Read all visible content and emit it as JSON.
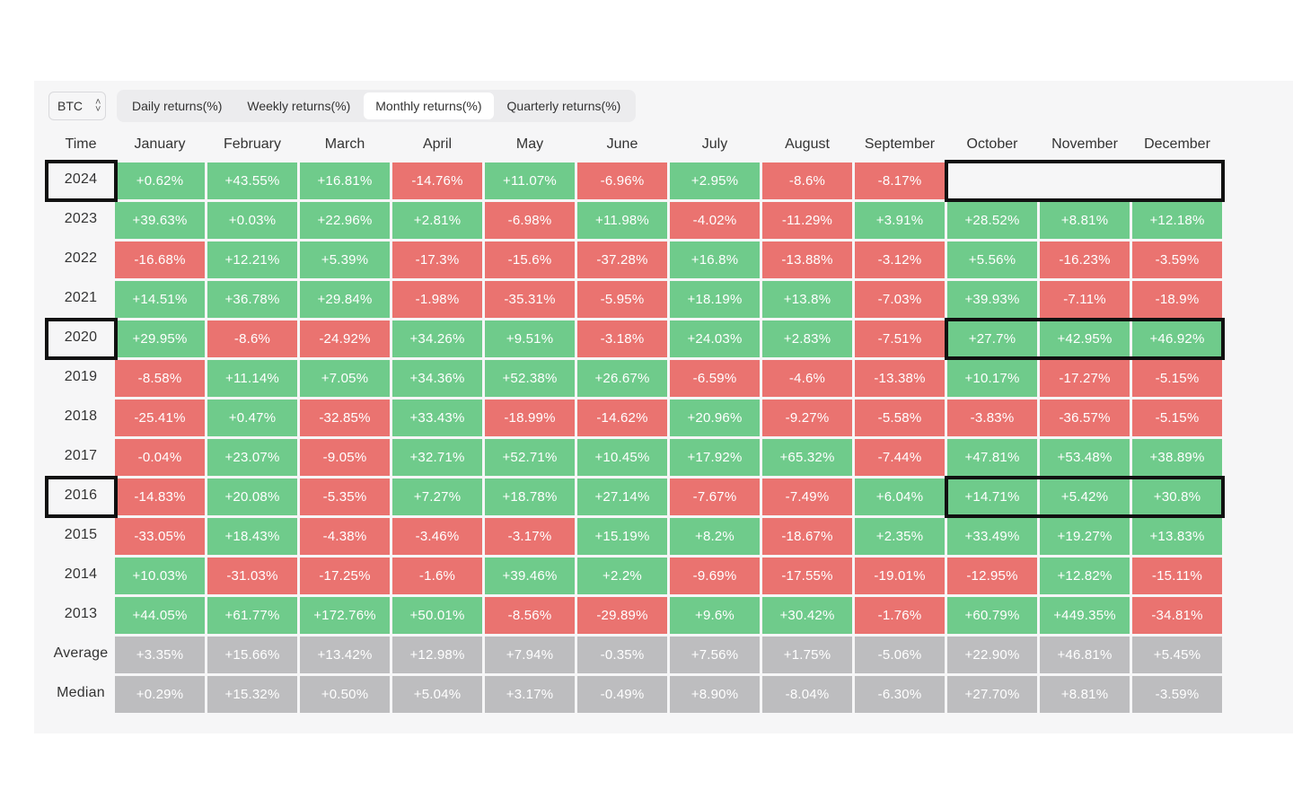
{
  "toolbar": {
    "asset": "BTC",
    "tabs": [
      {
        "label": "Daily returns(%)",
        "active": false
      },
      {
        "label": "Weekly returns(%)",
        "active": false
      },
      {
        "label": "Monthly returns(%)",
        "active": true
      },
      {
        "label": "Quarterly returns(%)",
        "active": false
      }
    ]
  },
  "colors": {
    "positive": "#6fcb8b",
    "negative": "#ea7370",
    "summary": "#bdbdbf",
    "highlight": "#111111"
  },
  "table": {
    "header": [
      "Time",
      "January",
      "February",
      "March",
      "April",
      "May",
      "June",
      "July",
      "August",
      "September",
      "October",
      "November",
      "December"
    ],
    "rows": [
      {
        "label": "2024",
        "values": [
          "+0.62%",
          "+43.55%",
          "+16.81%",
          "-14.76%",
          "+11.07%",
          "-6.96%",
          "+2.95%",
          "-8.6%",
          "-8.17%",
          "",
          "",
          ""
        ]
      },
      {
        "label": "2023",
        "values": [
          "+39.63%",
          "+0.03%",
          "+22.96%",
          "+2.81%",
          "-6.98%",
          "+11.98%",
          "-4.02%",
          "-11.29%",
          "+3.91%",
          "+28.52%",
          "+8.81%",
          "+12.18%"
        ]
      },
      {
        "label": "2022",
        "values": [
          "-16.68%",
          "+12.21%",
          "+5.39%",
          "-17.3%",
          "-15.6%",
          "-37.28%",
          "+16.8%",
          "-13.88%",
          "-3.12%",
          "+5.56%",
          "-16.23%",
          "-3.59%"
        ]
      },
      {
        "label": "2021",
        "values": [
          "+14.51%",
          "+36.78%",
          "+29.84%",
          "-1.98%",
          "-35.31%",
          "-5.95%",
          "+18.19%",
          "+13.8%",
          "-7.03%",
          "+39.93%",
          "-7.11%",
          "-18.9%"
        ]
      },
      {
        "label": "2020",
        "values": [
          "+29.95%",
          "-8.6%",
          "-24.92%",
          "+34.26%",
          "+9.51%",
          "-3.18%",
          "+24.03%",
          "+2.83%",
          "-7.51%",
          "+27.7%",
          "+42.95%",
          "+46.92%"
        ]
      },
      {
        "label": "2019",
        "values": [
          "-8.58%",
          "+11.14%",
          "+7.05%",
          "+34.36%",
          "+52.38%",
          "+26.67%",
          "-6.59%",
          "-4.6%",
          "-13.38%",
          "+10.17%",
          "-17.27%",
          "-5.15%"
        ]
      },
      {
        "label": "2018",
        "values": [
          "-25.41%",
          "+0.47%",
          "-32.85%",
          "+33.43%",
          "-18.99%",
          "-14.62%",
          "+20.96%",
          "-9.27%",
          "-5.58%",
          "-3.83%",
          "-36.57%",
          "-5.15%"
        ]
      },
      {
        "label": "2017",
        "values": [
          "-0.04%",
          "+23.07%",
          "-9.05%",
          "+32.71%",
          "+52.71%",
          "+10.45%",
          "+17.92%",
          "+65.32%",
          "-7.44%",
          "+47.81%",
          "+53.48%",
          "+38.89%"
        ]
      },
      {
        "label": "2016",
        "values": [
          "-14.83%",
          "+20.08%",
          "-5.35%",
          "+7.27%",
          "+18.78%",
          "+27.14%",
          "-7.67%",
          "-7.49%",
          "+6.04%",
          "+14.71%",
          "+5.42%",
          "+30.8%"
        ]
      },
      {
        "label": "2015",
        "values": [
          "-33.05%",
          "+18.43%",
          "-4.38%",
          "-3.46%",
          "-3.17%",
          "+15.19%",
          "+8.2%",
          "-18.67%",
          "+2.35%",
          "+33.49%",
          "+19.27%",
          "+13.83%"
        ]
      },
      {
        "label": "2014",
        "values": [
          "+10.03%",
          "-31.03%",
          "-17.25%",
          "-1.6%",
          "+39.46%",
          "+2.2%",
          "-9.69%",
          "-17.55%",
          "-19.01%",
          "-12.95%",
          "+12.82%",
          "-15.11%"
        ]
      },
      {
        "label": "2013",
        "values": [
          "+44.05%",
          "+61.77%",
          "+172.76%",
          "+50.01%",
          "-8.56%",
          "-29.89%",
          "+9.6%",
          "+30.42%",
          "-1.76%",
          "+60.79%",
          "+449.35%",
          "-34.81%"
        ]
      }
    ],
    "summary": [
      {
        "label": "Average",
        "values": [
          "+3.35%",
          "+15.66%",
          "+13.42%",
          "+12.98%",
          "+7.94%",
          "-0.35%",
          "+7.56%",
          "+1.75%",
          "-5.06%",
          "+22.90%",
          "+46.81%",
          "+5.45%"
        ]
      },
      {
        "label": "Median",
        "values": [
          "+0.29%",
          "+15.32%",
          "+0.50%",
          "+5.04%",
          "+3.17%",
          "-0.49%",
          "+8.90%",
          "-8.04%",
          "-6.30%",
          "+27.70%",
          "+8.81%",
          "-3.59%"
        ]
      }
    ]
  }
}
